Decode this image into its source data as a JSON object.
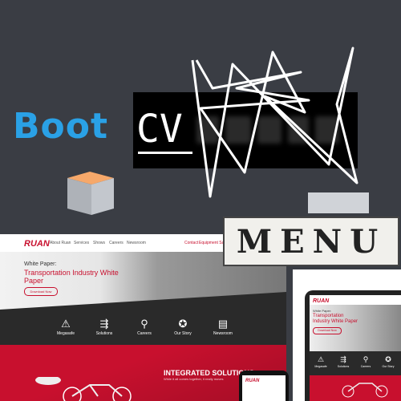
{
  "banner": {
    "boot": "Boot",
    "cv": "CV",
    "menu": "MENU"
  },
  "site": {
    "logo": "RUAN",
    "nav": [
      "About Ruan",
      "Services",
      "Shows",
      "Careers",
      "Newsroom"
    ],
    "nav_right": [
      "Contact",
      "Equipment Sales"
    ],
    "hero_kicker": "White Paper:",
    "hero_title": "Transportation Industry White Paper",
    "download": "Download Now",
    "icons": [
      {
        "name": "Megasafe",
        "glyph": "⚠"
      },
      {
        "name": "Solutions",
        "glyph": "⇶"
      },
      {
        "name": "Careers",
        "glyph": "⚲"
      },
      {
        "name": "Our Story",
        "glyph": "✪"
      },
      {
        "name": "Newsroom",
        "glyph": "▤"
      }
    ],
    "integrated_title": "INTEGRATED SOLUTIONS",
    "integrated_sub": "While it all comes together, it really moves"
  },
  "tablet": {
    "logo": "RUAN",
    "kicker": "White Paper:",
    "title": "Transportation Industry White Paper",
    "download": "Download Now",
    "icons": [
      {
        "name": "Megasafe",
        "glyph": "⚠"
      },
      {
        "name": "Solutions",
        "glyph": "⇶"
      },
      {
        "name": "Careers",
        "glyph": "⚲"
      },
      {
        "name": "Our Story",
        "glyph": "✪"
      }
    ]
  },
  "phone": {
    "logo": "RUAN"
  },
  "colors": {
    "brand_red": "#c8102e",
    "boot_blue": "#2aa1e6",
    "bg": "#3a3d44"
  }
}
